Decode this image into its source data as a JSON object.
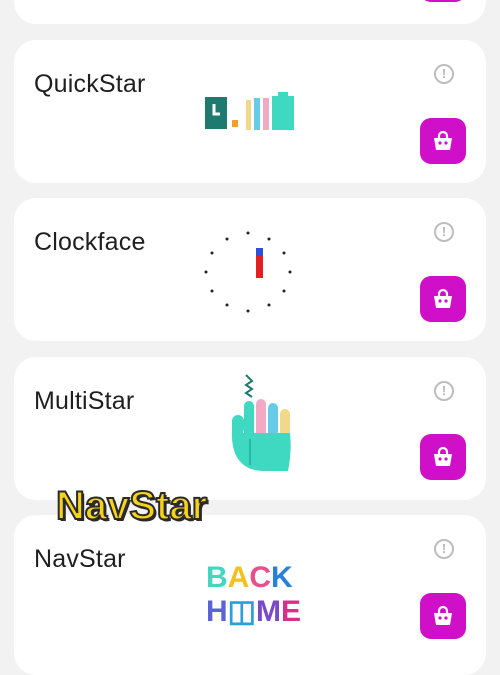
{
  "cards": [
    {
      "id": "top-partial"
    },
    {
      "id": "quickstar",
      "title": "QuickStar",
      "info_glyph": "!",
      "buy_icon": "shopping-bag-icon"
    },
    {
      "id": "clockface",
      "title": "Clockface",
      "info_glyph": "!",
      "buy_icon": "shopping-bag-icon"
    },
    {
      "id": "multistar",
      "title": "MultiStar",
      "info_glyph": "!",
      "buy_icon": "shopping-bag-icon"
    },
    {
      "id": "navstar",
      "title": "NavStar",
      "info_glyph": "!",
      "buy_icon": "shopping-bag-icon"
    }
  ],
  "overlay": {
    "label": "NavStar"
  },
  "navstar_graphic": {
    "line1": "BACK",
    "line2": "H◫ME"
  },
  "colors": {
    "accent": "#d010c8",
    "background": "#f2f2f2",
    "card": "#ffffff"
  }
}
